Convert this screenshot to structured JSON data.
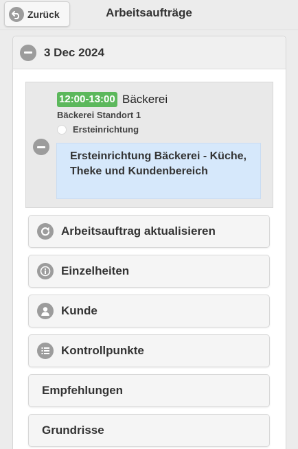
{
  "header": {
    "back_label": "Zurück",
    "title": "Arbeitsaufträge"
  },
  "date_section": {
    "date": "3 Dec 2024"
  },
  "job": {
    "time": "12:00-13:00",
    "title": "Bäckerei",
    "location": "Bäckerei Standort 1",
    "type": "Ersteinrichtung",
    "description": "Ersteinrichtung Bäckerei - Küche, Theke und Kundenbereich",
    "time_badge_color": "#5cb85c",
    "description_bg_color": "#d6e8fb"
  },
  "actions": [
    {
      "label": "Arbeitsauftrag aktualisieren",
      "icon": "refresh-icon"
    },
    {
      "label": "Einzelheiten",
      "icon": "info-icon"
    },
    {
      "label": "Kunde",
      "icon": "user-icon"
    },
    {
      "label": "Kontrollpunkte",
      "icon": "list-icon"
    },
    {
      "label": "Empfehlungen",
      "icon": ""
    },
    {
      "label": "Grundrisse",
      "icon": ""
    }
  ]
}
